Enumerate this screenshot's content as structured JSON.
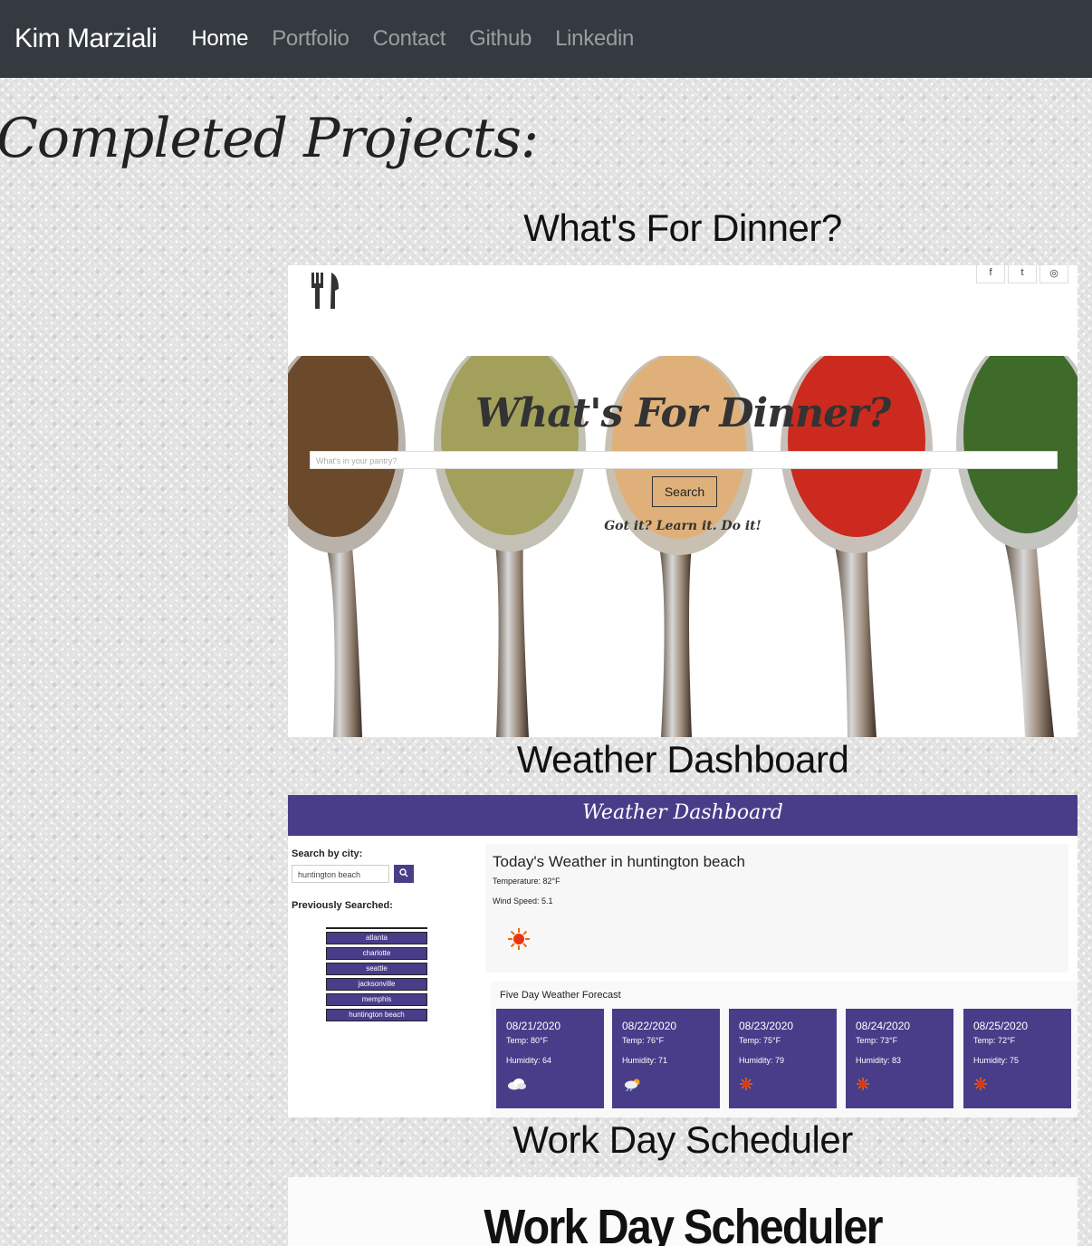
{
  "nav": {
    "brand": "Kim Marziali",
    "links": [
      {
        "label": "Home",
        "active": true
      },
      {
        "label": "Portfolio",
        "active": false
      },
      {
        "label": "Contact",
        "active": false
      },
      {
        "label": "Github",
        "active": false
      },
      {
        "label": "Linkedin",
        "active": false
      }
    ]
  },
  "heading": "Completed Projects:",
  "projects": [
    {
      "title": "What's For Dinner?",
      "screenshot": {
        "heading": "What's For Dinner?",
        "input_placeholder": "What's in your pantry?",
        "search_label": "Search",
        "tagline": "Got it? Learn it. Do it!",
        "social_icons": [
          "facebook-icon",
          "twitter-icon",
          "instagram-icon"
        ],
        "icon": "fork-knife-icon"
      }
    },
    {
      "title": "Weather Dashboard",
      "screenshot": {
        "header": "Weather Dashboard",
        "search_label": "Search by city:",
        "search_value": "huntington beach",
        "prev_label": "Previously Searched:",
        "prev_cities": [
          "atlanta",
          "charlotte",
          "seattle",
          "jacksonville",
          "memphis",
          "huntington beach"
        ],
        "today_title": "Today's Weather in huntington beach",
        "temperature": "Temperature: 82°F",
        "wind": "Wind Speed: 5.1",
        "today_icon": "sun-icon",
        "forecast_title": "Five Day Weather Forecast",
        "forecast": [
          {
            "date": "08/21/2020",
            "temp": "Temp: 80°F",
            "humidity": "Humidity: 64",
            "icon": "cloud-icon"
          },
          {
            "date": "08/22/2020",
            "temp": "Temp: 76°F",
            "humidity": "Humidity: 71",
            "icon": "storm-cloud-icon"
          },
          {
            "date": "08/23/2020",
            "temp": "Temp: 75°F",
            "humidity": "Humidity: 79",
            "icon": "sun-icon"
          },
          {
            "date": "08/24/2020",
            "temp": "Temp: 73°F",
            "humidity": "Humidity: 83",
            "icon": "sun-icon"
          },
          {
            "date": "08/25/2020",
            "temp": "Temp: 72°F",
            "humidity": "Humidity: 75",
            "icon": "sun-icon"
          }
        ],
        "colors": {
          "primary": "#493d8a"
        }
      }
    },
    {
      "title": "Work Day Scheduler",
      "screenshot": {
        "heading": "Work Day Scheduler"
      }
    }
  ],
  "colors": {
    "navbar": "#343a40",
    "nav_active": "#ffffff",
    "nav_inactive": "#9a9da1"
  }
}
